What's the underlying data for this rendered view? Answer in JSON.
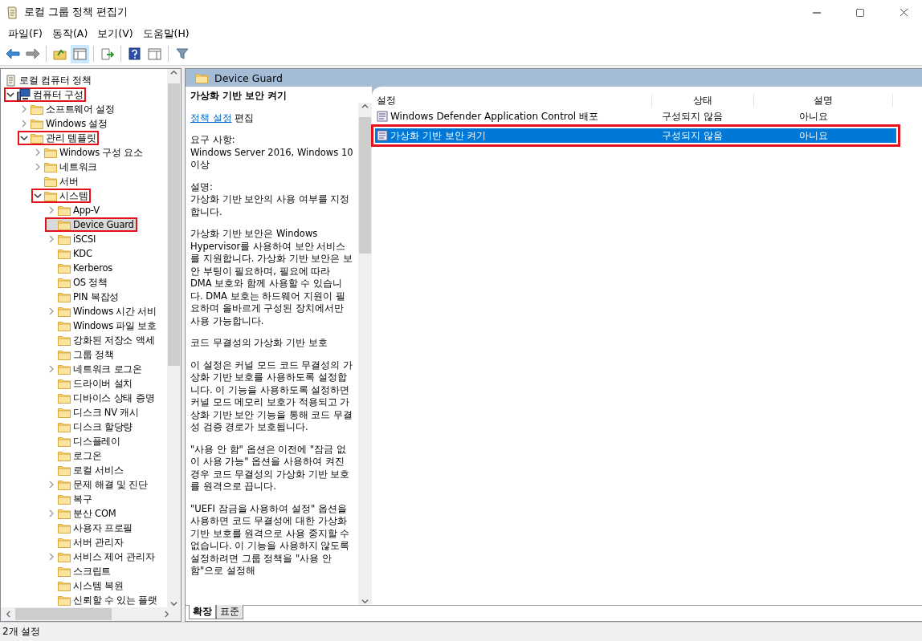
{
  "window": {
    "title": "로컬 그룹 정책 편집기"
  },
  "menu": [
    "파일(F)",
    "동작(A)",
    "보기(V)",
    "도움말(H)"
  ],
  "tree": [
    {
      "label": "로컬 컴퓨터 정책",
      "kind": "policy",
      "selected": false,
      "highlighted": false,
      "children": [
        {
          "label": "컴퓨터 구성",
          "kind": "computer",
          "expanded": true,
          "selected": false,
          "highlighted": true,
          "children": [
            {
              "label": "소프트웨어 설정",
              "kind": "folder",
              "expanded": false,
              "selected": false,
              "highlighted": false
            },
            {
              "label": "Windows 설정",
              "kind": "folder",
              "expanded": false,
              "selected": false,
              "highlighted": false
            },
            {
              "label": "관리 템플릿",
              "kind": "folder",
              "expanded": true,
              "selected": false,
              "highlighted": true,
              "children": [
                {
                  "label": "Windows 구성 요소",
                  "kind": "folder",
                  "expanded": false,
                  "selected": false,
                  "highlighted": false
                },
                {
                  "label": "네트워크",
                  "kind": "folder",
                  "expanded": false,
                  "selected": false,
                  "highlighted": false
                },
                {
                  "label": "서버",
                  "kind": "folder",
                  "selected": false,
                  "highlighted": false
                },
                {
                  "label": "시스템",
                  "kind": "folder",
                  "expanded": true,
                  "selected": false,
                  "highlighted": true,
                  "children": [
                    {
                      "label": "App-V",
                      "kind": "folder",
                      "expanded": false,
                      "selected": false,
                      "highlighted": false
                    },
                    {
                      "label": "Device Guard",
                      "kind": "folder",
                      "selected": true,
                      "highlighted": true
                    },
                    {
                      "label": "iSCSI",
                      "kind": "folder",
                      "expanded": false,
                      "selected": false,
                      "highlighted": false
                    },
                    {
                      "label": "KDC",
                      "kind": "folder",
                      "selected": false,
                      "highlighted": false
                    },
                    {
                      "label": "Kerberos",
                      "kind": "folder",
                      "selected": false,
                      "highlighted": false
                    },
                    {
                      "label": "OS 정책",
                      "kind": "folder",
                      "selected": false,
                      "highlighted": false
                    },
                    {
                      "label": "PIN 복잡성",
                      "kind": "folder",
                      "selected": false,
                      "highlighted": false
                    },
                    {
                      "label": "Windows 시간 서비",
                      "kind": "folder",
                      "expanded": false,
                      "selected": false,
                      "highlighted": false
                    },
                    {
                      "label": "Windows 파일 보호",
                      "kind": "folder",
                      "selected": false,
                      "highlighted": false
                    },
                    {
                      "label": "강화된 저장소 액세",
                      "kind": "folder",
                      "selected": false,
                      "highlighted": false
                    },
                    {
                      "label": "그룹 정책",
                      "kind": "folder",
                      "selected": false,
                      "highlighted": false
                    },
                    {
                      "label": "네트워크 로그온",
                      "kind": "folder",
                      "expanded": false,
                      "selected": false,
                      "highlighted": false
                    },
                    {
                      "label": "드라이버 설치",
                      "kind": "folder",
                      "selected": false,
                      "highlighted": false
                    },
                    {
                      "label": "디바이스 상태 증명",
                      "kind": "folder",
                      "selected": false,
                      "highlighted": false
                    },
                    {
                      "label": "디스크 NV 캐시",
                      "kind": "folder",
                      "selected": false,
                      "highlighted": false
                    },
                    {
                      "label": "디스크 할당량",
                      "kind": "folder",
                      "selected": false,
                      "highlighted": false
                    },
                    {
                      "label": "디스플레이",
                      "kind": "folder",
                      "selected": false,
                      "highlighted": false
                    },
                    {
                      "label": "로그온",
                      "kind": "folder",
                      "selected": false,
                      "highlighted": false
                    },
                    {
                      "label": "로컬 서비스",
                      "kind": "folder",
                      "selected": false,
                      "highlighted": false
                    },
                    {
                      "label": "문제 해결 및 진단",
                      "kind": "folder",
                      "expanded": false,
                      "selected": false,
                      "highlighted": false
                    },
                    {
                      "label": "복구",
                      "kind": "folder",
                      "selected": false,
                      "highlighted": false
                    },
                    {
                      "label": "분산 COM",
                      "kind": "folder",
                      "expanded": false,
                      "selected": false,
                      "highlighted": false
                    },
                    {
                      "label": "사용자 프로필",
                      "kind": "folder",
                      "selected": false,
                      "highlighted": false
                    },
                    {
                      "label": "서버 관리자",
                      "kind": "folder",
                      "selected": false,
                      "highlighted": false
                    },
                    {
                      "label": "서비스 제어 관리자",
                      "kind": "folder",
                      "expanded": false,
                      "selected": false,
                      "highlighted": false
                    },
                    {
                      "label": "스크립트",
                      "kind": "folder",
                      "selected": false,
                      "highlighted": false
                    },
                    {
                      "label": "시스템 복원",
                      "kind": "folder",
                      "selected": false,
                      "highlighted": false
                    },
                    {
                      "label": "신뢰할 수 있는 플랫",
                      "kind": "folder",
                      "selected": false,
                      "highlighted": false
                    }
                  ]
                }
              ]
            }
          ]
        }
      ]
    }
  ],
  "header": {
    "title": "Device Guard"
  },
  "details": {
    "title": "가상화 기반 보안 켜기",
    "edit_link": "정책 설정",
    "edit_text": "편집",
    "requirements_label": "요구 사항:",
    "requirements": "Windows Server 2016, Windows 10 이상",
    "description_label": "설명:",
    "paragraphs": [
      "가상화 기반 보안의 사용 여부를 지정합니다.",
      "가상화 기반 보안은 Windows Hypervisor를 사용하여 보안 서비스를 지원합니다. 가상화 기반 보안은 보안 부팅이 필요하며, 필요에 따라 DMA 보호와 함께 사용할 수 있습니다. DMA 보호는 하드웨어 지원이 필요하며 올바르게 구성된 장치에서만 사용 가능합니다.",
      "코드 무결성의 가상화 기반 보호",
      "이 설정은 커널 모드 코드 무결성의 가상화 기반 보호를 사용하도록 설정합니다. 이 기능을 사용하도록 설정하면 커널 모드 메모리 보호가 적용되고 가상화 기반 보안 기능을 통해 코드 무결성 검증 경로가 보호됩니다.",
      "\"사용 안 함\" 옵션은 이전에 \"잠금 없이 사용 가능\" 옵션을 사용하여 켜진 경우 코드 무결성의 가상화 기반 보호를 원격으로 끕니다.",
      "\"UEFI 잠금을 사용하여 설정\" 옵션을 사용하면 코드 무결성에 대한 가상화 기반 보호를 원격으로 사용 중지할 수 없습니다. 이 기능을 사용하지 않도록 설정하려면 그룹 정책을 \"사용 안 함\"으로 설정해"
    ]
  },
  "list": {
    "columns": [
      "설정",
      "상태",
      "설명"
    ],
    "rows": [
      {
        "cells": [
          "Windows Defender Application Control 배포",
          "구성되지 않음",
          "아니요"
        ],
        "selected": false,
        "highlighted": false
      },
      {
        "cells": [
          "가상화 기반 보안 켜기",
          "구성되지 않음",
          "아니요"
        ],
        "selected": true,
        "highlighted": true
      }
    ]
  },
  "tabs": [
    {
      "label": "확장",
      "selected": true
    },
    {
      "label": "표준",
      "selected": false
    }
  ],
  "status_bar": "2개 설정"
}
